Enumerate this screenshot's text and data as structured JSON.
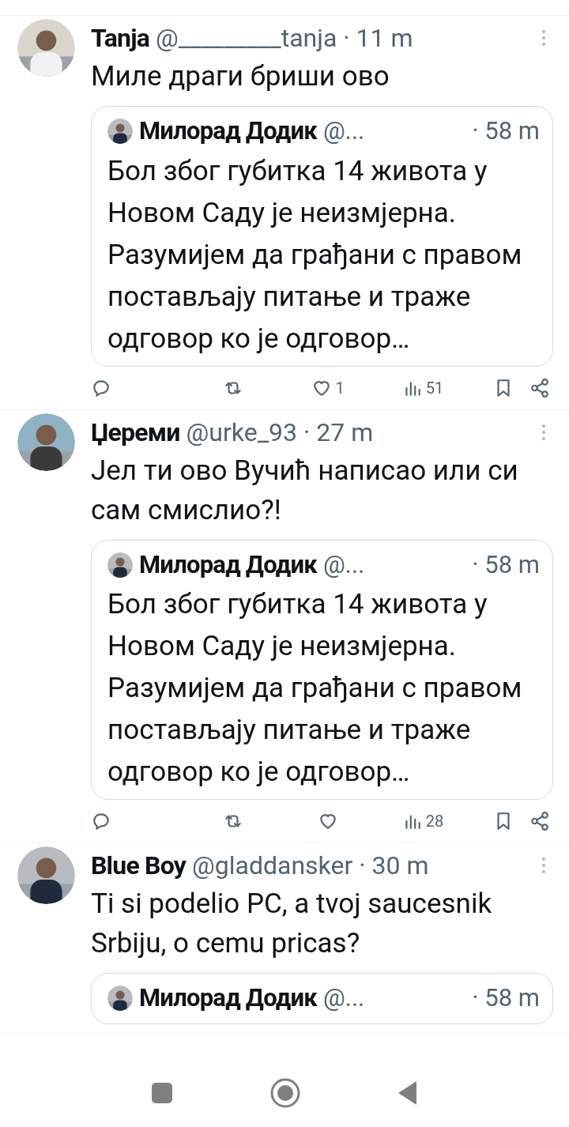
{
  "tweets": [
    {
      "author": "Tanja",
      "handle": "@_________tanja",
      "time": "· 11 m",
      "text": "Миле драги бриши ово",
      "quote": {
        "author": "Милорад Додик",
        "handle": "@...",
        "time": "· 58 m",
        "text": "Бол због губитка 14 живота у Новом Саду је неизмјерна. Разумијем да грађани с правом постављају питање и траже одговор ко је одговор…"
      },
      "actions": {
        "likes": "1",
        "views": "51"
      }
    },
    {
      "author": "Џереми",
      "handle": "@urke_93",
      "time": "· 27 m",
      "text": "Јел ти ово Вучић написао или си сам смислио?!",
      "quote": {
        "author": "Милорад Додик",
        "handle": "@...",
        "time": "· 58 m",
        "text": "Бол због губитка 14 живота у Новом Саду је неизмјерна. Разумијем да грађани с правом постављају питање и траже одговор ко је одговор…"
      },
      "actions": {
        "views": "28"
      }
    },
    {
      "author": "Blue Boy",
      "handle": "@gladdansker",
      "time": "· 30 m",
      "text": "Ti si podelio PC, a tvoj saucesnik Srbiju, o cemu pricas?",
      "quote": {
        "author": "Милорад Додик",
        "handle": "@...",
        "time": "· 58 m"
      }
    }
  ]
}
